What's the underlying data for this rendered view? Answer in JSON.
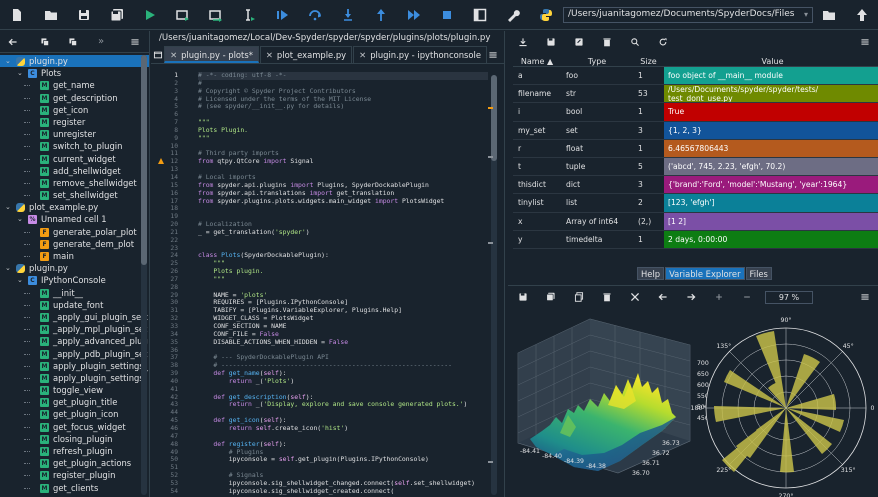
{
  "toolbar": {
    "path": "/Users/juanitagomez/Documents/SpyderDocs/Files",
    "icons": [
      "new-file",
      "open-file",
      "save-file",
      "save-all",
      "run",
      "run-cell",
      "run-cell-advance",
      "run-selection",
      "debug",
      "step",
      "step-into",
      "step-return",
      "continue",
      "stop",
      "maximize-pane",
      "preferences",
      "python-path",
      "folder",
      "up-arrow"
    ]
  },
  "outline": {
    "items": [
      {
        "label": "plugin.py",
        "level": 0,
        "icon": "py",
        "arrow": "v",
        "selected": true
      },
      {
        "label": "Plots",
        "level": 1,
        "icon": "C",
        "arrow": "v"
      },
      {
        "label": "get_name",
        "level": 2,
        "icon": "M"
      },
      {
        "label": "get_description",
        "level": 2,
        "icon": "M"
      },
      {
        "label": "get_icon",
        "level": 2,
        "icon": "M"
      },
      {
        "label": "register",
        "level": 2,
        "icon": "M"
      },
      {
        "label": "unregister",
        "level": 2,
        "icon": "M"
      },
      {
        "label": "switch_to_plugin",
        "level": 2,
        "icon": "M"
      },
      {
        "label": "current_widget",
        "level": 2,
        "icon": "M"
      },
      {
        "label": "add_shellwidget",
        "level": 2,
        "icon": "M"
      },
      {
        "label": "remove_shellwidget",
        "level": 2,
        "icon": "M"
      },
      {
        "label": "set_shellwidget",
        "level": 2,
        "icon": "M"
      },
      {
        "label": "plot_example.py",
        "level": 0,
        "icon": "py",
        "arrow": "v"
      },
      {
        "label": "Unnamed cell 1",
        "level": 1,
        "icon": "%",
        "arrow": "v"
      },
      {
        "label": "generate_polar_plot",
        "level": 2,
        "icon": "F"
      },
      {
        "label": "generate_dem_plot",
        "level": 2,
        "icon": "F"
      },
      {
        "label": "main",
        "level": 2,
        "icon": "F"
      },
      {
        "label": "plugin.py",
        "level": 0,
        "icon": "py",
        "arrow": "v"
      },
      {
        "label": "IPythonConsole",
        "level": 1,
        "icon": "C",
        "arrow": "v"
      },
      {
        "label": "__init__",
        "level": 2,
        "icon": "M"
      },
      {
        "label": "update_font",
        "level": 2,
        "icon": "M"
      },
      {
        "label": "_apply_gui_plugin_sett",
        "level": 2,
        "icon": "M"
      },
      {
        "label": "_apply_mpl_plugin_set",
        "level": 2,
        "icon": "M"
      },
      {
        "label": "_apply_advanced_plug",
        "level": 2,
        "icon": "M"
      },
      {
        "label": "_apply_pdb_plugin_set",
        "level": 2,
        "icon": "M"
      },
      {
        "label": "apply_plugin_settings_",
        "level": 2,
        "icon": "M"
      },
      {
        "label": "apply_plugin_settings",
        "level": 2,
        "icon": "M"
      },
      {
        "label": "toggle_view",
        "level": 2,
        "icon": "M"
      },
      {
        "label": "get_plugin_title",
        "level": 2,
        "icon": "M"
      },
      {
        "label": "get_plugin_icon",
        "level": 2,
        "icon": "M"
      },
      {
        "label": "get_focus_widget",
        "level": 2,
        "icon": "M"
      },
      {
        "label": "closing_plugin",
        "level": 2,
        "icon": "M"
      },
      {
        "label": "refresh_plugin",
        "level": 2,
        "icon": "M"
      },
      {
        "label": "get_plugin_actions",
        "level": 2,
        "icon": "M"
      },
      {
        "label": "register_plugin",
        "level": 2,
        "icon": "M"
      },
      {
        "label": "get_clients",
        "level": 2,
        "icon": "M"
      }
    ]
  },
  "editor": {
    "path": "/Users/juanitagomez/Local/Dev-Spyder/spyder/spyder/plugins/plots/plugin.py",
    "tabs": [
      {
        "label": "plugin.py - plots*",
        "active": true
      },
      {
        "label": "plot_example.py",
        "active": false
      },
      {
        "label": "plugin.py - ipythonconsole",
        "active": false
      }
    ],
    "current_line": 1,
    "lines": [
      [
        [
          "c-com",
          "# -*- coding: utf-8 -*-"
        ]
      ],
      [
        [
          "c-com",
          "#"
        ]
      ],
      [
        [
          "c-com",
          "# Copyright © Spyder Project Contributors"
        ]
      ],
      [
        [
          "c-com",
          "# Licensed under the terms of the MIT License"
        ]
      ],
      [
        [
          "c-com",
          "# (see spyder/__init__.py for details)"
        ]
      ],
      [
        [
          "",
          ""
        ]
      ],
      [
        [
          "c-str",
          "\"\"\""
        ]
      ],
      [
        [
          "c-str",
          "Plots Plugin."
        ]
      ],
      [
        [
          "c-str",
          "\"\"\""
        ]
      ],
      [
        [
          "",
          ""
        ]
      ],
      [
        [
          "c-com",
          "# Third party imports"
        ]
      ],
      [
        [
          "c-kw",
          "from"
        ],
        [
          "",
          " qtpy.QtCore "
        ],
        [
          "c-kw",
          "import"
        ],
        [
          "",
          " Signal"
        ]
      ],
      [
        [
          "",
          ""
        ]
      ],
      [
        [
          "c-com",
          "# Local imports"
        ]
      ],
      [
        [
          "c-kw",
          "from"
        ],
        [
          "",
          " spyder.api.plugins "
        ],
        [
          "c-kw",
          "import"
        ],
        [
          "",
          " Plugins, SpyderDockablePlugin"
        ]
      ],
      [
        [
          "c-kw",
          "from"
        ],
        [
          "",
          " spyder.api.translations "
        ],
        [
          "c-kw",
          "import"
        ],
        [
          "",
          " get_translation"
        ]
      ],
      [
        [
          "c-kw",
          "from"
        ],
        [
          "",
          " spyder.plugins.plots.widgets.main_widget "
        ],
        [
          "c-kw",
          "import"
        ],
        [
          "",
          " PlotsWidget"
        ]
      ],
      [
        [
          "",
          ""
        ]
      ],
      [
        [
          "",
          ""
        ]
      ],
      [
        [
          "c-com",
          "# Localization"
        ]
      ],
      [
        [
          "",
          "_ = get_translation("
        ],
        [
          "c-str",
          "'spyder'"
        ],
        [
          "",
          ")"
        ]
      ],
      [
        [
          "",
          ""
        ]
      ],
      [
        [
          "",
          ""
        ]
      ],
      [
        [
          "c-kw",
          "class"
        ],
        [
          "",
          " "
        ],
        [
          "c-def",
          "Plots"
        ],
        [
          "",
          "(SpyderDockablePlugin):"
        ]
      ],
      [
        [
          "",
          "    "
        ],
        [
          "c-str",
          "\"\"\""
        ]
      ],
      [
        [
          "c-str",
          "    Plots plugin."
        ]
      ],
      [
        [
          "",
          "    "
        ],
        [
          "c-str",
          "\"\"\""
        ]
      ],
      [
        [
          "",
          ""
        ]
      ],
      [
        [
          "",
          "    NAME = "
        ],
        [
          "c-str",
          "'plots'"
        ]
      ],
      [
        [
          "",
          "    REQUIRES = [Plugins.IPythonConsole]"
        ]
      ],
      [
        [
          "",
          "    TABIFY = [Plugins.VariableExplorer, Plugins.Help]"
        ]
      ],
      [
        [
          "",
          "    WIDGET_CLASS = PlotsWidget"
        ]
      ],
      [
        [
          "",
          "    CONF_SECTION = NAME"
        ]
      ],
      [
        [
          "",
          "    CONF_FILE = "
        ],
        [
          "c-kw",
          "False"
        ]
      ],
      [
        [
          "",
          "    DISABLE_ACTIONS_WHEN_HIDDEN = "
        ],
        [
          "c-kw",
          "False"
        ]
      ],
      [
        [
          "",
          ""
        ]
      ],
      [
        [
          "c-com",
          "    # --- SpyderDockablePlugin API"
        ]
      ],
      [
        [
          "c-com",
          "    # ------------------------------------------------------------"
        ]
      ],
      [
        [
          "",
          "    "
        ],
        [
          "c-kw",
          "def"
        ],
        [
          "",
          " "
        ],
        [
          "c-def",
          "get_name"
        ],
        [
          "",
          "("
        ],
        [
          "c-self",
          "self"
        ],
        [
          "",
          "):"
        ]
      ],
      [
        [
          "",
          "        "
        ],
        [
          "c-kw",
          "return"
        ],
        [
          "",
          " _("
        ],
        [
          "c-str",
          "'Plots'"
        ],
        [
          "",
          ")"
        ]
      ],
      [
        [
          "",
          ""
        ]
      ],
      [
        [
          "",
          "    "
        ],
        [
          "c-kw",
          "def"
        ],
        [
          "",
          " "
        ],
        [
          "c-def",
          "get_description"
        ],
        [
          "",
          "("
        ],
        [
          "c-self",
          "self"
        ],
        [
          "",
          "):"
        ]
      ],
      [
        [
          "",
          "        "
        ],
        [
          "c-kw",
          "return"
        ],
        [
          "",
          " _("
        ],
        [
          "c-str",
          "'Display, explore and save console generated plots.'"
        ],
        [
          "",
          ")"
        ]
      ],
      [
        [
          "",
          ""
        ]
      ],
      [
        [
          "",
          "    "
        ],
        [
          "c-kw",
          "def"
        ],
        [
          "",
          " "
        ],
        [
          "c-def",
          "get_icon"
        ],
        [
          "",
          "("
        ],
        [
          "c-self",
          "self"
        ],
        [
          "",
          "):"
        ]
      ],
      [
        [
          "",
          "        "
        ],
        [
          "c-kw",
          "return"
        ],
        [
          "",
          " "
        ],
        [
          "c-self",
          "self"
        ],
        [
          "",
          ".create_icon("
        ],
        [
          "c-str",
          "'hist'"
        ],
        [
          "",
          ")"
        ]
      ],
      [
        [
          "",
          ""
        ]
      ],
      [
        [
          "",
          "    "
        ],
        [
          "c-kw",
          "def"
        ],
        [
          "",
          " "
        ],
        [
          "c-def",
          "register"
        ],
        [
          "",
          "("
        ],
        [
          "c-self",
          "self"
        ],
        [
          "",
          "):"
        ]
      ],
      [
        [
          "c-com",
          "        # Plugins"
        ]
      ],
      [
        [
          "",
          "        ipyconsole = "
        ],
        [
          "c-self",
          "self"
        ],
        [
          "",
          ".get_plugin(Plugins.IPythonConsole)"
        ]
      ],
      [
        [
          "",
          ""
        ]
      ],
      [
        [
          "c-com",
          "        # Signals"
        ]
      ],
      [
        [
          "",
          "        ipyconsole.sig_shellwidget_changed.connect("
        ],
        [
          "c-self",
          "self"
        ],
        [
          "",
          ".set_shellwidget)"
        ]
      ],
      [
        [
          "",
          "        ipyconsole.sig_shellwidget_created.connect("
        ]
      ]
    ]
  },
  "variable_explorer": {
    "columns": [
      "Name ▲",
      "Type",
      "Size",
      "Value"
    ],
    "rows": [
      {
        "name": "a",
        "type": "foo",
        "size": "1",
        "value": "foo object of __main__ module",
        "color": "#13a090"
      },
      {
        "name": "filename",
        "type": "str",
        "size": "53",
        "value": "/Users/Documents/spyder/spyder/tests/ test_dont_use.py",
        "color": "#6f8a00",
        "two_line": true
      },
      {
        "name": "i",
        "type": "bool",
        "size": "1",
        "value": "True",
        "color": "#c10000"
      },
      {
        "name": "my_set",
        "type": "set",
        "size": "3",
        "value": "{1, 2, 3}",
        "color": "#12549a"
      },
      {
        "name": "r",
        "type": "float",
        "size": "1",
        "value": "6.46567806443",
        "color": "#b45a1e"
      },
      {
        "name": "t",
        "type": "tuple",
        "size": "5",
        "value": "('abcd', 745, 2.23, 'efgh', 70.2)",
        "color": "#6d6d84"
      },
      {
        "name": "thisdict",
        "type": "dict",
        "size": "3",
        "value": "{'brand':'Ford', 'model':'Mustang', 'year':1964}",
        "color": "#9a1b7c"
      },
      {
        "name": "tinylist",
        "type": "list",
        "size": "2",
        "value": "[123, 'efgh']",
        "color": "#0b8098"
      },
      {
        "name": "x",
        "type": "Array of int64",
        "size": "(2,)",
        "value": "[1 2]",
        "color": "#7b4fa6"
      },
      {
        "name": "y",
        "type": "timedelta",
        "size": "1",
        "value": "2 days, 0:00:00",
        "color": "#0d7d13"
      }
    ],
    "tabs": [
      {
        "label": "Help",
        "active": false
      },
      {
        "label": "Variable Explorer",
        "active": true
      },
      {
        "label": "Files",
        "active": false
      }
    ]
  },
  "plots": {
    "zoom": "97 %",
    "surface_axis": {
      "z_ticks": [
        "700",
        "650",
        "600",
        "550",
        "500",
        "450"
      ],
      "y_ticks": [
        "36.73",
        "36.72",
        "36.71",
        "36.70"
      ],
      "x_ticks": [
        "-84.41",
        "-84.40",
        "-84.39",
        "-84.38"
      ]
    },
    "polar_axis": {
      "angle_labels": [
        "90°",
        "45°",
        "0°",
        "315°",
        "270°",
        "225°",
        "180°",
        "135°"
      ]
    }
  }
}
